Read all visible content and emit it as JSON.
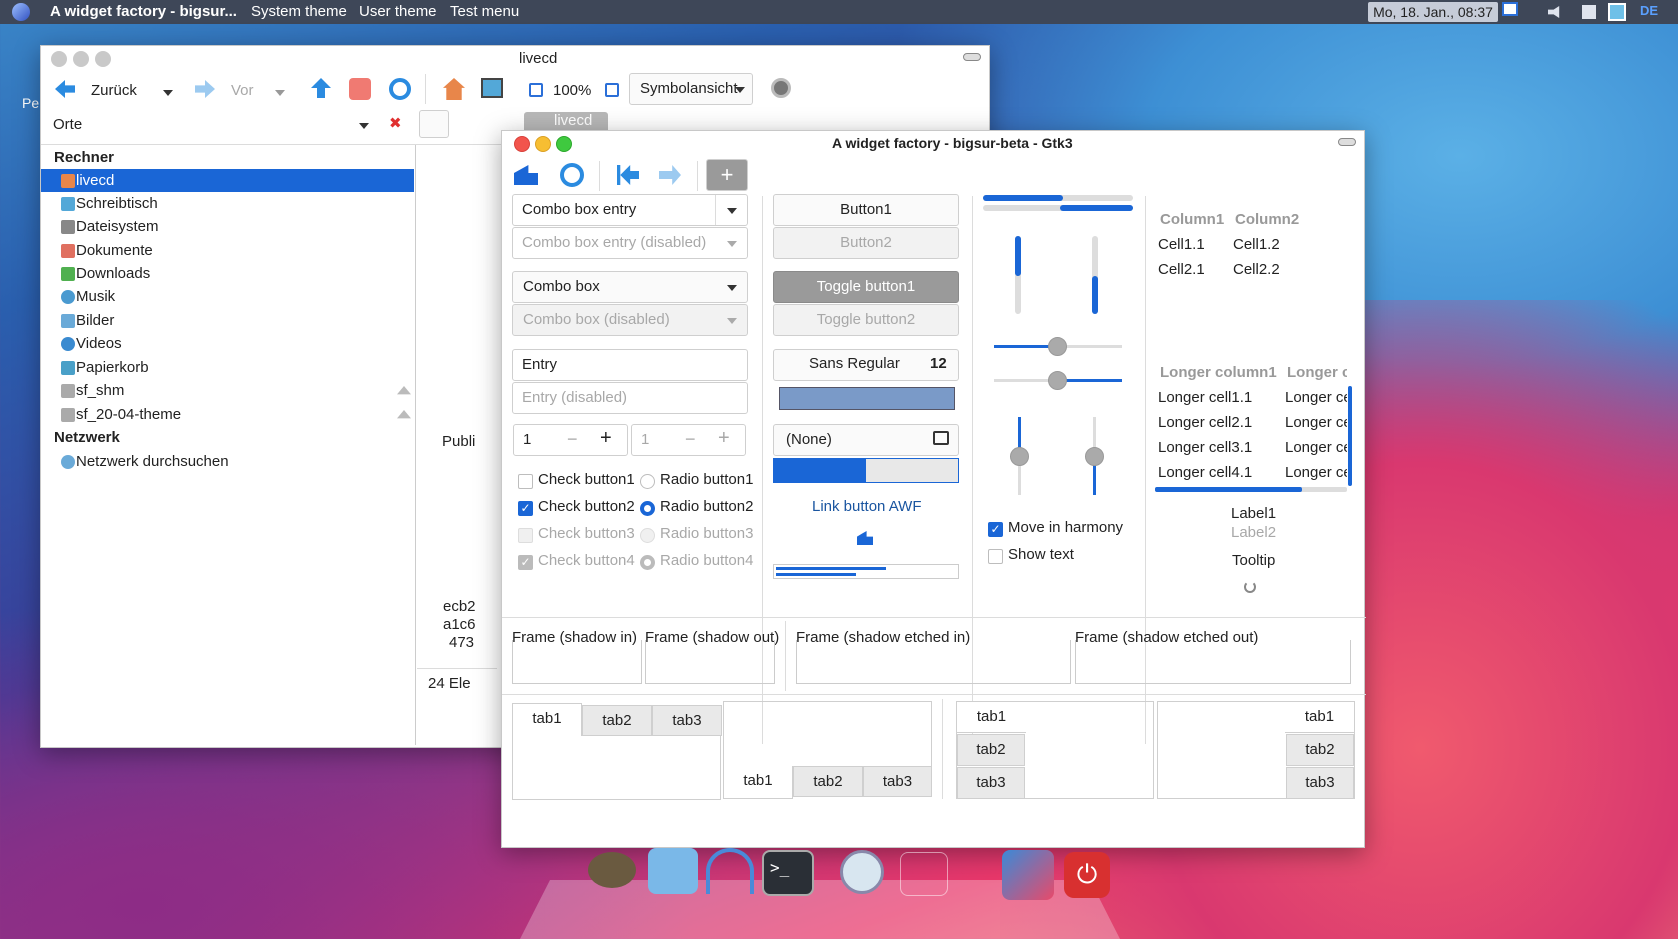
{
  "panel": {
    "app": "A widget factory - bigsur...",
    "menus": [
      "System theme",
      "User theme",
      "Test menu"
    ],
    "clock": "Mo, 18. Jan., 08:37",
    "kbd": "DE"
  },
  "desktop": {
    "icon_label": "Pe"
  },
  "fm": {
    "title": "livecd",
    "back": "Zurück",
    "fwd": "Vor",
    "zoom": "100%",
    "view": "Symbolansicht",
    "places": "Orte",
    "sections": [
      "Rechner",
      "Netzwerk"
    ],
    "items": [
      "livecd",
      "Schreibtisch",
      "Dateisystem",
      "Dokumente",
      "Downloads",
      "Musik",
      "Bilder",
      "Videos",
      "Papierkorb",
      "sf_shm",
      "sf_20-04-theme"
    ],
    "net_item": "Netzwerk durchsuchen",
    "tab": "livecd",
    "partial": [
      "Publi",
      "ecb2",
      "a1c6",
      "473"
    ],
    "status": "24 Ele"
  },
  "wf": {
    "title": "A widget factory - bigsur-beta - Gtk3",
    "combo_entry": "Combo box entry",
    "combo_entry_dis": "Combo box entry (disabled)",
    "combo": "Combo box",
    "combo_dis": "Combo box (disabled)",
    "entry": "Entry",
    "entry_dis": "Entry (disabled)",
    "spin1": "1",
    "spin2": "1",
    "checks": [
      "Check button1",
      "Check button2",
      "Check button3",
      "Check button4"
    ],
    "radios": [
      "Radio button1",
      "Radio button2",
      "Radio button3",
      "Radio button4"
    ],
    "button1": "Button1",
    "button2": "Button2",
    "toggle1": "Toggle button1",
    "toggle2": "Toggle button2",
    "font": "Sans Regular",
    "font_size": "12",
    "file": "(None)",
    "link": "Link button AWF",
    "progress": 0.5,
    "move": "Move in harmony",
    "showtext": "Show text",
    "tree1": {
      "headers": [
        "Column1",
        "Column2"
      ],
      "rows": [
        [
          "Cell1.1",
          "Cell1.2"
        ],
        [
          "Cell2.1",
          "Cell2.2"
        ]
      ]
    },
    "tree2": {
      "headers": [
        "Longer column1",
        "Longer c"
      ],
      "rows": [
        [
          "Longer cell1.1",
          "Longer ce"
        ],
        [
          "Longer cell2.1",
          "Longer ce"
        ],
        [
          "Longer cell3.1",
          "Longer ce"
        ],
        [
          "Longer cell4.1",
          "Longer ce"
        ]
      ]
    },
    "label1": "Label1",
    "label2": "Label2",
    "tooltip": "Tooltip",
    "frames": [
      "Frame (shadow in)",
      "Frame (shadow out)",
      "Frame (shadow etched in)",
      "Frame (shadow etched out)"
    ],
    "tabs": [
      "tab1",
      "tab2",
      "tab3"
    ]
  },
  "colors": {
    "accent": "#1a66d6",
    "selection": "#1a66d6"
  }
}
